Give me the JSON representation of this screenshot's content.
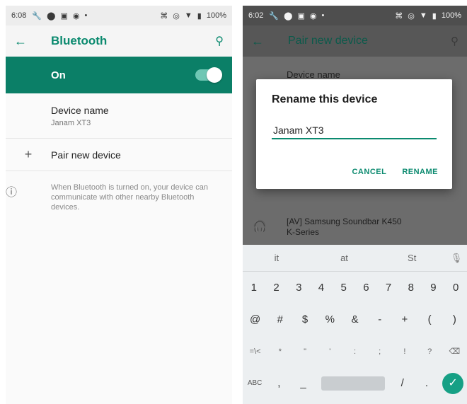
{
  "left": {
    "status": {
      "time": "6:08",
      "battery": "100%"
    },
    "appbar": {
      "title": "Bluetooth"
    },
    "on_label": "On",
    "device_name": {
      "title": "Device name",
      "value": "Janam XT3"
    },
    "pair": {
      "label": "Pair new device"
    },
    "info": {
      "text": "When Bluetooth is turned on, your device can communicate with other nearby Bluetooth devices."
    }
  },
  "right": {
    "status": {
      "time": "6:02",
      "battery": "100%"
    },
    "appbar": {
      "title": "Pair new device"
    },
    "device_name_label": "Device name",
    "device_item": {
      "line1": "[AV] Samsung Soundbar K450",
      "line2": "K-Series"
    },
    "dialog": {
      "title": "Rename this device",
      "input_value": "Janam XT3",
      "cancel": "CANCEL",
      "rename": "RENAME"
    },
    "keyboard": {
      "suggestions": [
        "it",
        "at",
        "St"
      ],
      "row_numbers": [
        "1",
        "2",
        "3",
        "4",
        "5",
        "6",
        "7",
        "8",
        "9",
        "0"
      ],
      "row_symbols": [
        "@",
        "#",
        "$",
        "%",
        "&",
        "-",
        "+",
        "(",
        ")"
      ],
      "row_more": [
        "=\\<",
        "*",
        "\"",
        "'",
        ":",
        ";",
        "!",
        "?"
      ],
      "row_bottom": {
        "abc": "ABC",
        "comma": ",",
        "underscore": "_",
        "slash": "/",
        "period": "."
      }
    }
  },
  "icons": {
    "back": "arrow-left-icon",
    "search": "search-icon",
    "plus": "plus-icon",
    "info": "info-icon",
    "headphones": "headphones-icon",
    "mic": "mic-icon",
    "backspace": "backspace-icon",
    "done": "check-icon"
  },
  "colors": {
    "accent": "#0b8a6f",
    "onbar": "#0b7f67"
  }
}
